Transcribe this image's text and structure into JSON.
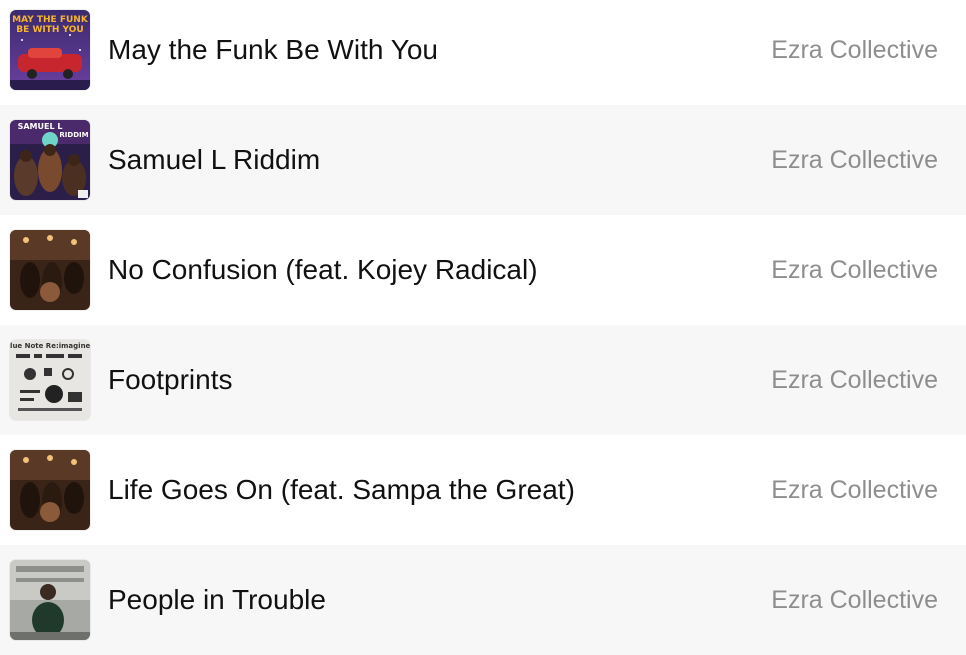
{
  "tracks": [
    {
      "title": "May the Funk Be With You",
      "artist": "Ezra Collective",
      "artwork": "may-the-funk-be-with-you-artwork",
      "artwork_text": [
        "MAY THE FUNK",
        "BE WITH YOU"
      ]
    },
    {
      "title": "Samuel L Riddim",
      "artist": "Ezra Collective",
      "artwork": "samuel-l-riddim-artwork",
      "artwork_text": [
        "SAMUEL L",
        "RIDDIM"
      ]
    },
    {
      "title": "No Confusion (feat. Kojey Radical)",
      "artist": "Ezra Collective",
      "artwork": "band-photo-artwork"
    },
    {
      "title": "Footprints",
      "artist": "Ezra Collective",
      "artwork": "blue-note-reimagined-artwork",
      "artwork_text": [
        "Blue Note Re:imagined"
      ]
    },
    {
      "title": "Life Goes On (feat. Sampa the Great)",
      "artist": "Ezra Collective",
      "artwork": "band-photo-artwork"
    },
    {
      "title": "People in Trouble",
      "artist": "Ezra Collective",
      "artwork": "portrait-photo-artwork"
    }
  ],
  "colors": {
    "title": "#111111",
    "artist": "#8e8e8e",
    "row_alt": "#f7f7f7"
  }
}
